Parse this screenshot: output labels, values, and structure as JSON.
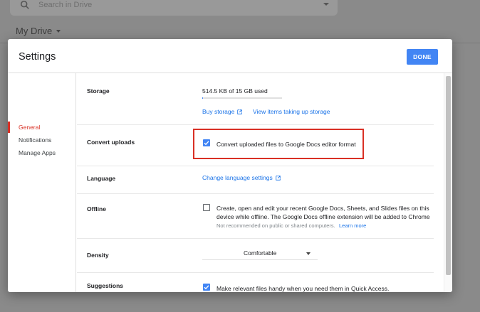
{
  "background": {
    "search_placeholder": "Search in Drive",
    "location": "My Drive"
  },
  "dialog": {
    "title": "Settings",
    "done_label": "DONE"
  },
  "sidebar": {
    "items": [
      {
        "label": "General",
        "active": true
      },
      {
        "label": "Notifications",
        "active": false
      },
      {
        "label": "Manage Apps",
        "active": false
      }
    ]
  },
  "storage": {
    "label": "Storage",
    "used_text": "514.5 KB of 15 GB used",
    "used_fraction": 3e-05,
    "buy_link": "Buy storage",
    "view_link": "View items taking up storage"
  },
  "convert": {
    "label": "Convert uploads",
    "checkbox_label": "Convert uploaded files to Google Docs editor format",
    "checked": true
  },
  "language": {
    "label": "Language",
    "link": "Change language settings"
  },
  "offline": {
    "label": "Offline",
    "line1": "Create, open and edit your recent Google Docs, Sheets, and Slides files on this",
    "line2": "device while offline. The Google Docs offline extension will be added to Chrome",
    "note": "Not recommended on public or shared computers.",
    "learn_more": "Learn more",
    "checked": false
  },
  "density": {
    "label": "Density",
    "value": "Comfortable"
  },
  "suggestions": {
    "label": "Suggestions",
    "checkbox_label": "Make relevant files handy when you need them in Quick Access.",
    "checked": true
  },
  "colors": {
    "accent": "#4285f4",
    "active": "#d93025",
    "link": "#1a73e8",
    "highlight_border": "#d93025"
  }
}
